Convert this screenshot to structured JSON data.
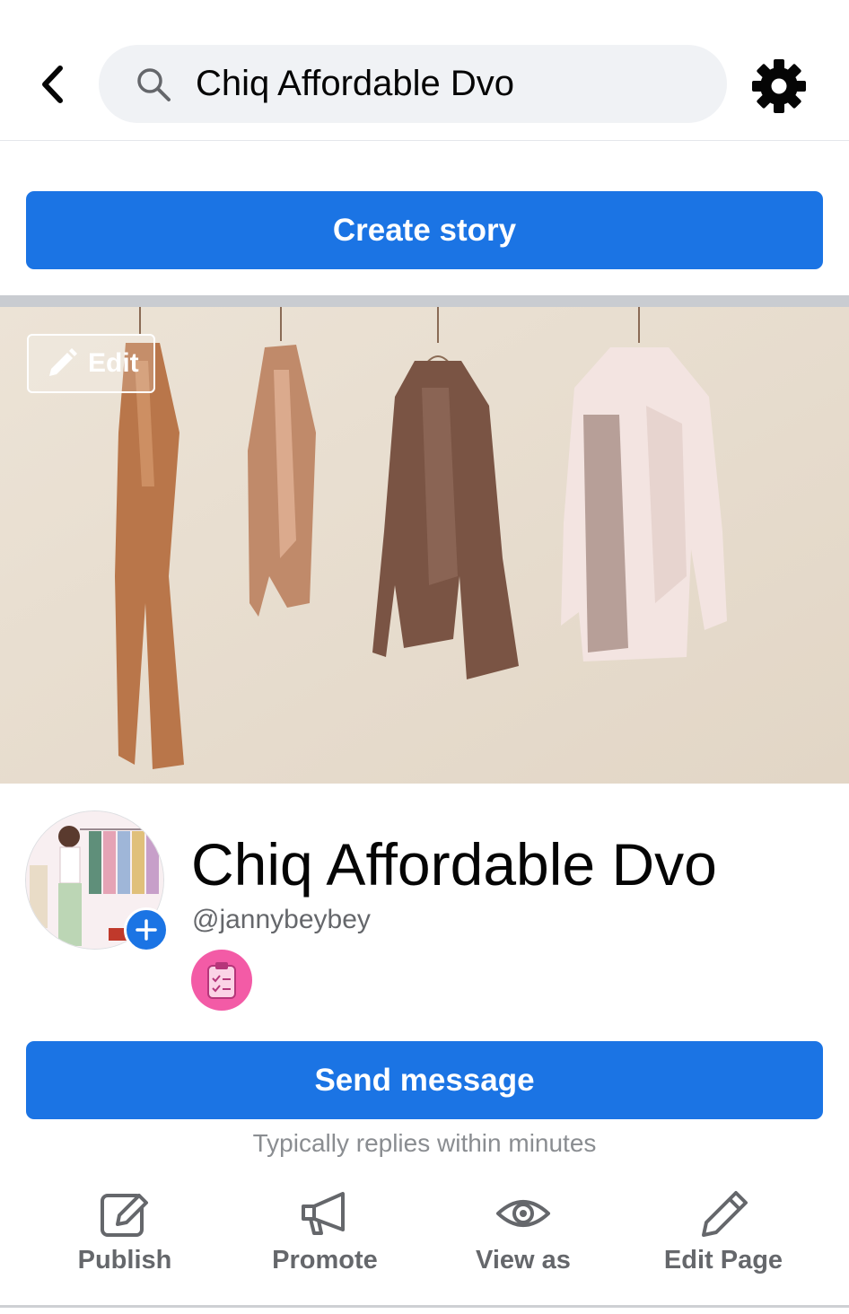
{
  "header": {
    "search_text": "Chiq Affordable Dvo"
  },
  "create_story_label": "Create story",
  "cover": {
    "edit_label": "Edit"
  },
  "profile": {
    "name": "Chiq Affordable Dvo",
    "username": "@jannybeybey"
  },
  "send_message_label": "Send message",
  "reply_note": "Typically replies within minutes",
  "actions": [
    {
      "label": "Publish",
      "icon": "publish-icon"
    },
    {
      "label": "Promote",
      "icon": "megaphone-icon"
    },
    {
      "label": "View as",
      "icon": "eye-icon"
    },
    {
      "label": "Edit Page",
      "icon": "pencil-icon"
    }
  ],
  "colors": {
    "accent": "#1b74e4",
    "badge": "#f35ba6",
    "secondary_text": "#65676b"
  }
}
